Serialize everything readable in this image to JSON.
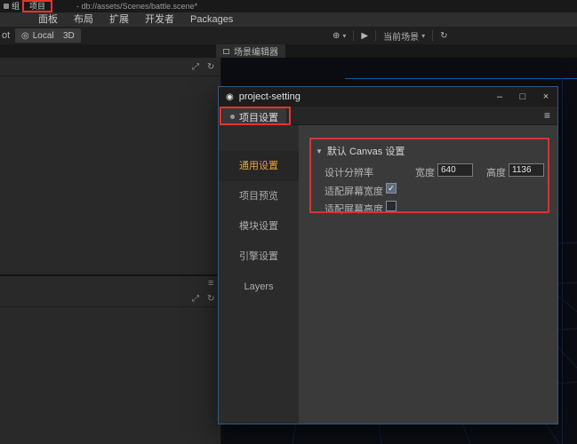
{
  "titlebar": {
    "group_label": "组",
    "project_menu_label": "项目",
    "window_title": "- db://assets/Scenes/battle.scene*"
  },
  "menubar": {
    "items": [
      "面板",
      "布局",
      "扩展",
      "开发者",
      "Packages"
    ]
  },
  "toolbar": {
    "pivot_label": "ot",
    "local_button": "Local",
    "mode_3d_button": "3D",
    "scene_select_value": "当前场景"
  },
  "scene_tab": {
    "label": "场景编辑器"
  },
  "icons": {
    "globe": "◎",
    "compile": "⊕",
    "dropdown": "▾",
    "play": "▶",
    "refresh": "↻",
    "expand": "⤢",
    "panel_menu": "≡",
    "hamburger": "≡",
    "logo": "◉",
    "collapse": "▼"
  },
  "dialog": {
    "window_title": "project-setting",
    "controls": {
      "minimize": "–",
      "maximize": "□",
      "close": "×"
    },
    "tab_label": "项目设置",
    "sidebar_items": [
      "通用设置",
      "项目预览",
      "模块设置",
      "引擎设置",
      "Layers"
    ],
    "sidebar_selected": "通用设置",
    "canvas_section": {
      "title": "默认 Canvas 设置",
      "design_resolution_label": "设计分辨率",
      "width_label": "宽度",
      "width_value": "640",
      "height_label": "高度",
      "height_value": "1136",
      "fit_width_label": "适配屏幕宽度",
      "fit_width_checked": true,
      "fit_width_glyph": "✓",
      "fit_height_label": "适配屏幕高度",
      "fit_height_checked": false,
      "fit_height_glyph": ""
    }
  },
  "colors": {
    "annotation_red": "#e5342e",
    "selected_item_orange": "#e8a33d",
    "scene_guide_blue": "#1e5aa8"
  }
}
